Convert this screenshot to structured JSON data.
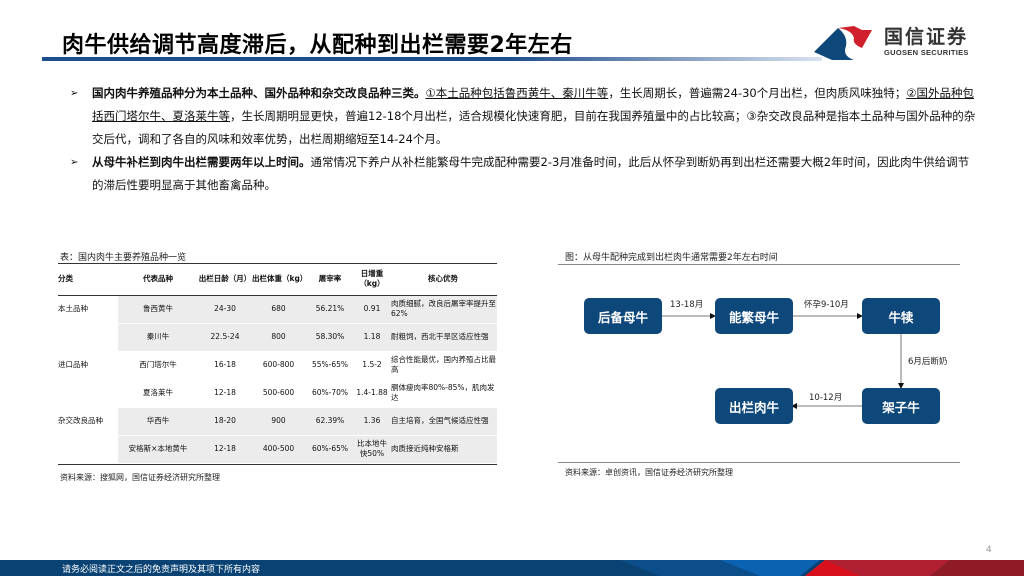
{
  "title": "肉牛供给调节高度滞后，从配种到出栏需要2年左右",
  "logo": {
    "cn": "国信证券",
    "en": "GUOSEN SECURITIES"
  },
  "bullets": [
    {
      "bold": "国内肉牛养殖品种分为本土品种、国外品种和杂交改良品种三类。",
      "u1": "①本土品种包括鲁西黄牛、秦川牛等",
      "t1": "，生长周期长，普遍需24-30个月出栏，但肉质风味独特；",
      "u2": "②国外品种包括西门塔尔牛、夏洛莱牛等",
      "t2": "，生长周期明显更快，普遍12-18个月出栏，适合规模化快速育肥，目前在我国养殖量中的占比较高；③杂交改良品种是指本土品种与国外品种的杂交后代，调和了各自的风味和效率优势，出栏周期缩短至14-24个月。"
    },
    {
      "bold": "从母牛补栏到肉牛出栏需要两年以上时间。",
      "t1": "通常情况下养户从补栏能繁母牛完成配种需要2-3月准备时间，此后从怀孕到断奶再到出栏还需要大概2年时间，因此肉牛供给调节的滞后性要明显高于其他畜禽品种。"
    }
  ],
  "table": {
    "caption": "表：国内肉牛主要养殖品种一览",
    "headers": [
      "分类",
      "代表品种",
      "出栏日龄（月）",
      "出栏体重（kg）",
      "屠宰率",
      "日增重（kg）",
      "核心优势"
    ],
    "rows": [
      [
        "本土品种",
        "鲁西黄牛",
        "24-30",
        "680",
        "56.21%",
        "0.91",
        "肉质细腻，改良后屠宰率提升至62%"
      ],
      [
        "",
        "秦川牛",
        "22.5-24",
        "800",
        "58.30%",
        "1.18",
        "耐粗饲，西北干旱区适应性强"
      ],
      [
        "进口品种",
        "西门塔尔牛",
        "16-18",
        "600-800",
        "55%-65%",
        "1.5-2",
        "综合性能最优，国内养殖占比最高"
      ],
      [
        "",
        "夏洛莱牛",
        "12-18",
        "500-600",
        "60%-70%",
        "1.4-1.88",
        "胴体瘦肉率80%-85%，肌肉发达"
      ],
      [
        "杂交改良品种",
        "华西牛",
        "18-20",
        "900",
        "62.39%",
        "1.36",
        "自主培育，全国气候适应性强"
      ],
      [
        "",
        "安格斯×本地黄牛",
        "12-18",
        "400-500",
        "60%-65%",
        "比本地牛快50%",
        "肉质接近纯种安格斯"
      ]
    ],
    "source": "资料来源：搜狐网，国信证券经济研究所整理"
  },
  "diagram": {
    "caption": "图：从母牛配种完成到出栏肉牛通常需要2年左右时间",
    "nodes": [
      "后备母牛",
      "能繁母牛",
      "牛犊",
      "架子牛",
      "出栏肉牛"
    ],
    "edges": [
      "13-18月",
      "怀孕9-10月",
      "6月后断奶",
      "10-12月"
    ],
    "source": "资料来源：卓创资讯，国信证券经济研究所整理"
  },
  "page_number": "4",
  "footer": "请务必阅读正文之后的免责声明及其项下所有内容",
  "colors": {
    "brand_blue": "#0e477a",
    "brand_red": "#d0202e"
  }
}
